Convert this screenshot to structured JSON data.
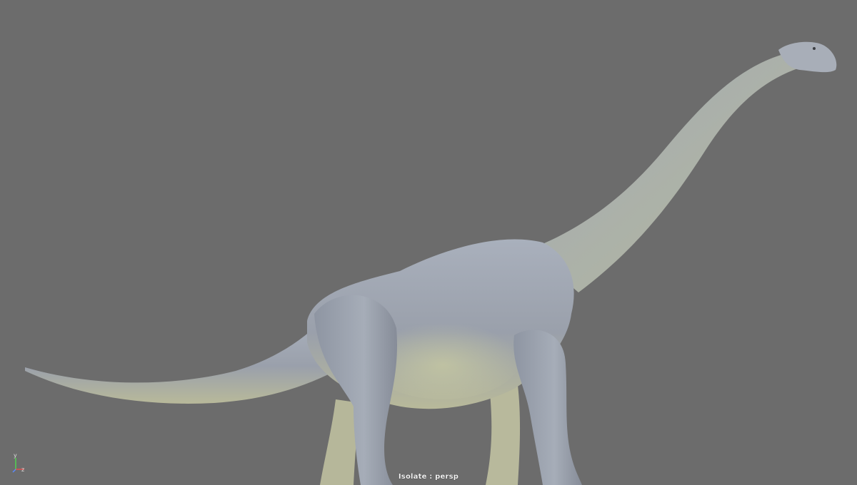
{
  "viewport": {
    "hud_label": "Isolate : persp",
    "background_color": "#6c6c6c"
  },
  "axis_gizmo": {
    "y_label": "y",
    "z_label": "z",
    "y_color": "#4fd34f",
    "x_color": "#e05050",
    "z_color": "#5a8cff"
  },
  "model": {
    "subject": "brachiosaurus-sculpt",
    "skin_color": "#9ca3b0",
    "belly_tint": "#c8c89a"
  }
}
